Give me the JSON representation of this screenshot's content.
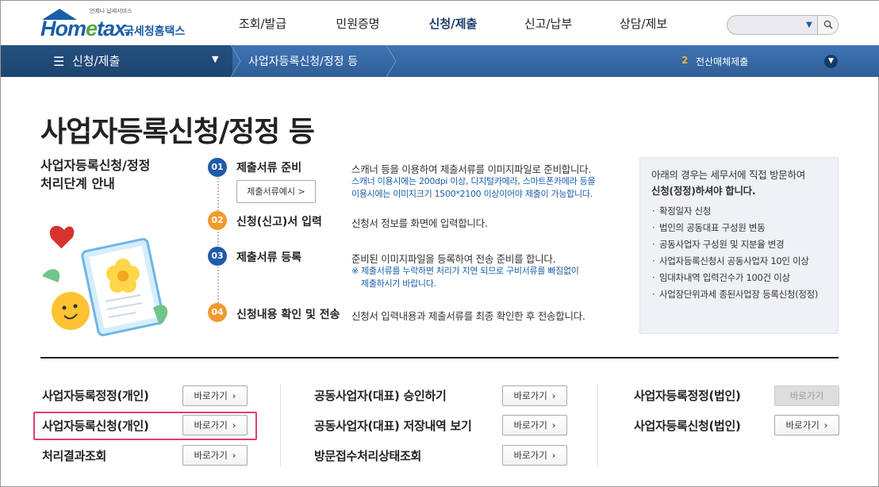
{
  "header": {
    "logo_small": "언제나 납세서비스",
    "logo_main_a": "Hom",
    "logo_main_e": "e",
    "logo_main_b": "tax.",
    "logo_kor": "국세청홈택스",
    "gnb": [
      {
        "label": "조회/발급",
        "active": false
      },
      {
        "label": "민원증명",
        "active": false
      },
      {
        "label": "신청/제출",
        "active": true
      },
      {
        "label": "신고/납부",
        "active": false
      },
      {
        "label": "상담/제보",
        "active": false
      }
    ],
    "search_placeholder": ""
  },
  "subbar": {
    "title": "신청/제출",
    "breadcrumb": "사업자등록신청/정정 등",
    "right_num": "2",
    "right_label": "전산매체제출"
  },
  "page": {
    "title": "사업자등록신청/정정 등",
    "guide_title_line1": "사업자등록신청/정정",
    "guide_title_line2": "처리단계 안내"
  },
  "steps": [
    {
      "num": "01",
      "label": "제출서류 준비",
      "desc": "스캐너 등을 이용하여 제출서류를 이미지파일로 준비합니다.",
      "note1": "스캐너 이용시에는 200dpi 이상, 디지털카메라, 스마트폰카메라 등을",
      "note2": "이용시에는 이미지크기 1500*2100 이상이어야 제출이 가능합니다.",
      "button": "제출서류예시 >"
    },
    {
      "num": "02",
      "label": "신청(신고)서 입력",
      "desc": "신청서 정보를 화면에 입력합니다."
    },
    {
      "num": "03",
      "label": "제출서류 등록",
      "desc": "준비된 이미지파일을 등록하여 전송 준비를 합니다.",
      "note1": "※ 제출서류를 누락하면 처리가 지연 되므로 구비서류를 빠짐없이",
      "note2": "제출하시기 바랍니다."
    },
    {
      "num": "04",
      "label": "신청내용 확인 및 전송",
      "desc": "신청서 입력내용과 제출서류를 최종 확인한 후 전송합니다."
    }
  ],
  "sidebox": {
    "title_a": "아래의 경우는 세무서에 직접 방문하여",
    "title_b": "신청(정정)하셔야 합니다.",
    "items": [
      "확정일자 신청",
      "법인의 공동대표 구성원 변동",
      "공동사업자 구성원 및 지분율 변경",
      "사업자등록신청시 공동사업자 10인 이상",
      "임대차내역 입력건수가 100건 이상",
      "사업장단위과세 종된사업장 등록신청(정정)"
    ]
  },
  "links": {
    "go_label": "바로가기",
    "col1": [
      "사업자등록정정(개인)",
      "사업자등록신청(개인)",
      "처리결과조회"
    ],
    "col2": [
      "공동사업자(대표) 승인하기",
      "공동사업자(대표) 저장내역 보기",
      "방문접수처리상태조회"
    ],
    "col3": [
      "사업자등록정정(법인)",
      "사업자등록신청(법인)"
    ]
  }
}
